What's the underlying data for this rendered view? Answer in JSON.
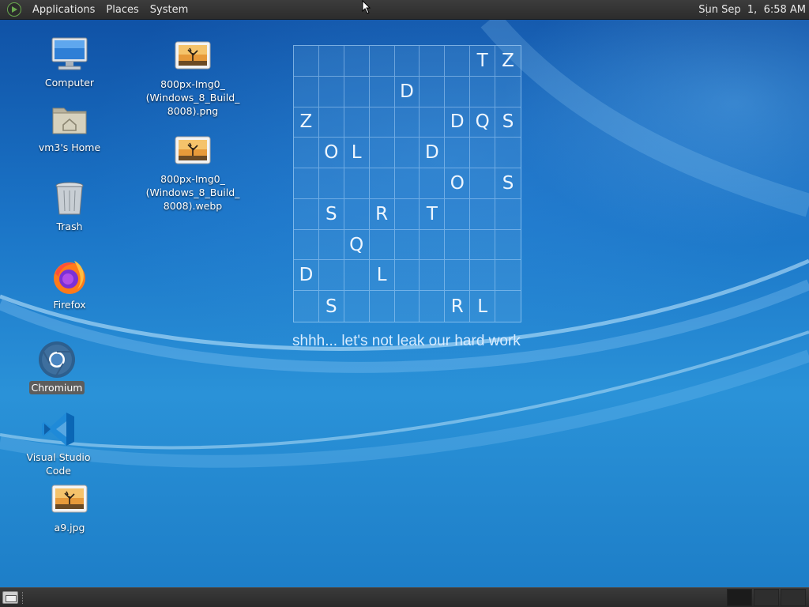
{
  "top_panel": {
    "menus": [
      "Applications",
      "Places",
      "System"
    ],
    "clock": "Sun Sep  1,  6:58 AM"
  },
  "desktop_icons": [
    {
      "label": "Computer",
      "icon": "computer-icon"
    },
    {
      "label": "vm3's Home",
      "icon": "home-folder-icon"
    },
    {
      "label": "Trash",
      "icon": "trash-icon"
    },
    {
      "label": "Firefox",
      "icon": "firefox-icon"
    },
    {
      "label": "Chromium",
      "icon": "chromium-icon",
      "selected": true
    },
    {
      "label": "Visual Studio Code",
      "icon": "vscode-icon"
    },
    {
      "label": "a9.jpg",
      "icon": "image-file-icon"
    },
    {
      "label": "800px-Img0_\n(Windows_8_Build_\n8008).png",
      "icon": "image-file-icon"
    },
    {
      "label": "800px-Img0_\n(Windows_8_Build_\n8008).webp",
      "icon": "image-file-icon"
    }
  ],
  "wallpaper": {
    "grid": [
      [
        "",
        "",
        "",
        "",
        "",
        "",
        "",
        "T",
        "Z"
      ],
      [
        "",
        "",
        "",
        "",
        "D",
        "",
        "",
        "",
        ""
      ],
      [
        "Z",
        "",
        "",
        "",
        "",
        "",
        "D",
        "Q",
        "S"
      ],
      [
        "",
        "O",
        "L",
        "",
        "",
        "D",
        "",
        "",
        ""
      ],
      [
        "",
        "",
        "",
        "",
        "",
        "",
        "O",
        "",
        "S"
      ],
      [
        "",
        "S",
        "",
        "R",
        "",
        "T",
        "",
        "",
        ""
      ],
      [
        "",
        "",
        "Q",
        "",
        "",
        "",
        "",
        "",
        ""
      ],
      [
        "D",
        "",
        "",
        "L",
        "",
        "",
        "",
        "",
        ""
      ],
      [
        "",
        "S",
        "",
        "",
        "",
        "",
        "R",
        "L",
        ""
      ]
    ],
    "tagline": "shhh... let's not leak our hard work"
  },
  "colors": {
    "panel": "#2c2c2c",
    "wallpaper_blue": "#1a73c6",
    "selection": "#5d5d5d"
  }
}
